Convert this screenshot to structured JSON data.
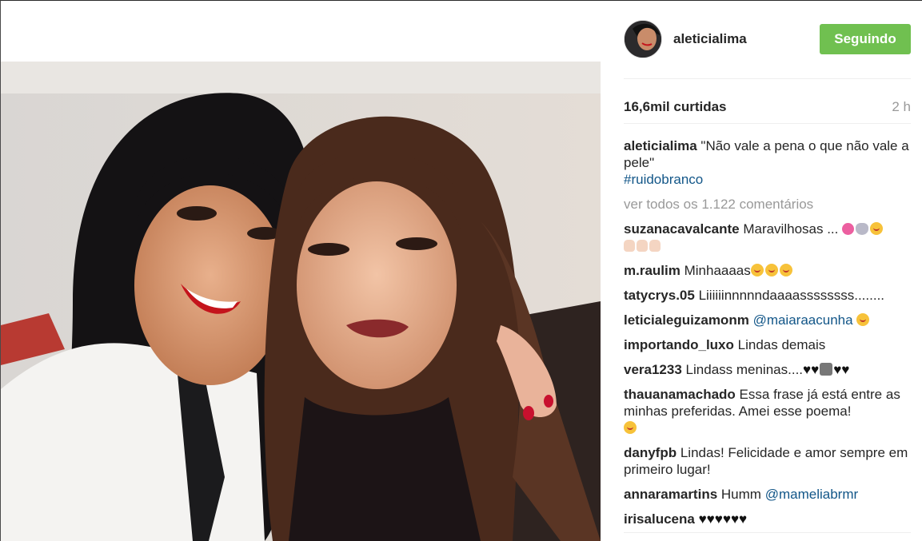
{
  "post": {
    "username": "aleticialima",
    "follow_label": "Seguindo",
    "likes": "16,6mil curtidas",
    "time": "2 h"
  },
  "caption": {
    "username": "aleticialima",
    "text": "\"Não vale a pena o que não vale a pele\"",
    "hashtag": "#ruidobranco"
  },
  "view_all": "ver todos os 1.122 comentários",
  "comments": [
    {
      "user": "suzanacavalcante",
      "text": "Maravilhosas ..."
    },
    {
      "user": "m.raulim",
      "text": "Minhaaaas"
    },
    {
      "user": "tatycrys.05",
      "text": "Liiiiiinnnnndaaaassssssss........"
    },
    {
      "user": "leticialeguizamonm",
      "mention": "@maiaraacunha"
    },
    {
      "user": "importando_luxo",
      "text": "Lindas demais"
    },
    {
      "user": "vera1233",
      "text": "Lindass meninas...."
    },
    {
      "user": "thauanamachado",
      "text": "Essa frase já está entre as minhas preferidas. Amei esse poema!"
    },
    {
      "user": "danyfpb",
      "text": "Lindas! Felicidade e amor sempre em primeiro lugar!"
    },
    {
      "user": "annaramartins",
      "text": "Humm",
      "mention": "@mameliabrmr"
    },
    {
      "user": "irisalucena",
      "text": "♥♥♥♥♥♥"
    }
  ],
  "colors": {
    "follow_button": "#70c050",
    "hashtag": "#125688",
    "muted": "#999999"
  }
}
